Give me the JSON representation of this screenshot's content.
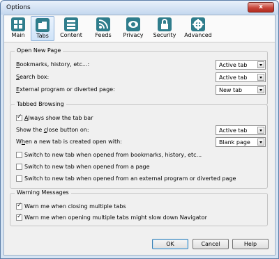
{
  "window": {
    "title": "Options",
    "close_label": "x"
  },
  "toolbar": {
    "items": [
      {
        "label": "Main",
        "icon": "main-icon"
      },
      {
        "label": "Tabs",
        "icon": "tabs-icon",
        "selected": true
      },
      {
        "label": "Content",
        "icon": "content-icon"
      },
      {
        "label": "Feeds",
        "icon": "feeds-icon"
      },
      {
        "label": "Privacy",
        "icon": "privacy-icon"
      },
      {
        "label": "Security",
        "icon": "security-icon"
      },
      {
        "label": "Advanced",
        "icon": "advanced-icon"
      }
    ]
  },
  "open_new_page": {
    "title": "Open New Page",
    "rows": [
      {
        "u": "B",
        "rest": "ookmarks, history, etc...:",
        "value": "Active tab"
      },
      {
        "u": "S",
        "rest": "earch box:",
        "value": "Active tab"
      },
      {
        "u": "E",
        "rest": "xternal program or diverted page:",
        "value": "New tab"
      }
    ]
  },
  "tabbed_browsing": {
    "title": "Tabbed Browsing",
    "always_show": {
      "u": "A",
      "rest": "lways show the tab bar",
      "checked": true
    },
    "close_button": {
      "pre": "Show the ",
      "u": "c",
      "rest": "lose button on:",
      "value": "Active tab"
    },
    "new_tab_with": {
      "pre": "W",
      "u": "h",
      "rest": "en a new tab is created open with:",
      "value": "Blank page"
    },
    "switch_options": [
      {
        "text": "Switch to new tab when opened from bookmarks, history, etc...",
        "checked": false
      },
      {
        "text": "Switch to new tab when opened from a page",
        "checked": false
      },
      {
        "text": "Switch to new tab when opened from an external program or diverted page",
        "checked": false
      }
    ]
  },
  "warning_messages": {
    "title": "Warning Messages",
    "options": [
      {
        "text": "Warn me when closing multiple tabs",
        "checked": true
      },
      {
        "text": "Warn me when opening multiple tabs might slow down Navigator",
        "checked": true
      }
    ]
  },
  "buttons": {
    "ok": "OK",
    "cancel": "Cancel",
    "help": "Help"
  },
  "colors": {
    "accent": "#2f7d8c",
    "frame": "#d6e4f3",
    "close": "#c8463a"
  }
}
